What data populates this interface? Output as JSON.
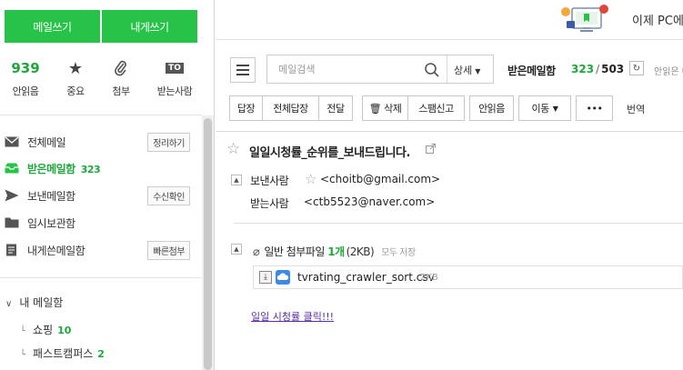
{
  "sidebar": {
    "compose_label": "메일쓰기",
    "self_compose_label": "내게쓰기",
    "quick": {
      "unread_count": "939",
      "unread_label": "안읽음",
      "important_label": "중요",
      "attachment_label": "첨부",
      "to_badge": "TO",
      "to_me_label": "받는사람"
    },
    "folders": [
      {
        "name": "전체메일",
        "button": "정리하기"
      },
      {
        "name": "받은메일함",
        "count": "323"
      },
      {
        "name": "보낸메일함",
        "button": "수신확인"
      },
      {
        "name": "임시보관함"
      },
      {
        "name": "내게쓴메일함",
        "button": "빠른첨부"
      }
    ],
    "mybox": {
      "label": "내 메일함",
      "items": [
        {
          "name": "쇼핑",
          "count": "10"
        },
        {
          "name": "패스트캠퍼스",
          "count": "2"
        }
      ]
    }
  },
  "header": {
    "promo_text": "이제 PC에"
  },
  "search": {
    "placeholder": "메일검색",
    "option_label": "상세"
  },
  "mailbox": {
    "title": "받은메일함",
    "unread": "323",
    "total": "503",
    "extra": "안읽은 메"
  },
  "toolbar": {
    "reply": "답장",
    "reply_all": "전체답장",
    "forward": "전달",
    "delete": "삭제",
    "spam": "스팸신고",
    "mark_unread": "안읽음",
    "move": "이동",
    "more": "•••",
    "translate": "번역"
  },
  "message": {
    "subject": "일일시청률_순위를_보내드립니다.",
    "from_label": "보낸사람",
    "from": "<choitb@gmail.com>",
    "to_label": "받는사람",
    "to": "<ctb5523@naver.com>",
    "attachments": {
      "label": "일반 첨부파일",
      "count": "1개",
      "size": "(2KB)",
      "save_all": "모두 저장",
      "files": [
        {
          "name": "tvrating_crawler_sort.csv",
          "size": "2KB"
        }
      ]
    },
    "body_link": "일일 시청률 클릭!!!"
  },
  "colors": {
    "accent": "#27c248",
    "accent_text": "#1ea83c",
    "link": "#5a2da0"
  }
}
